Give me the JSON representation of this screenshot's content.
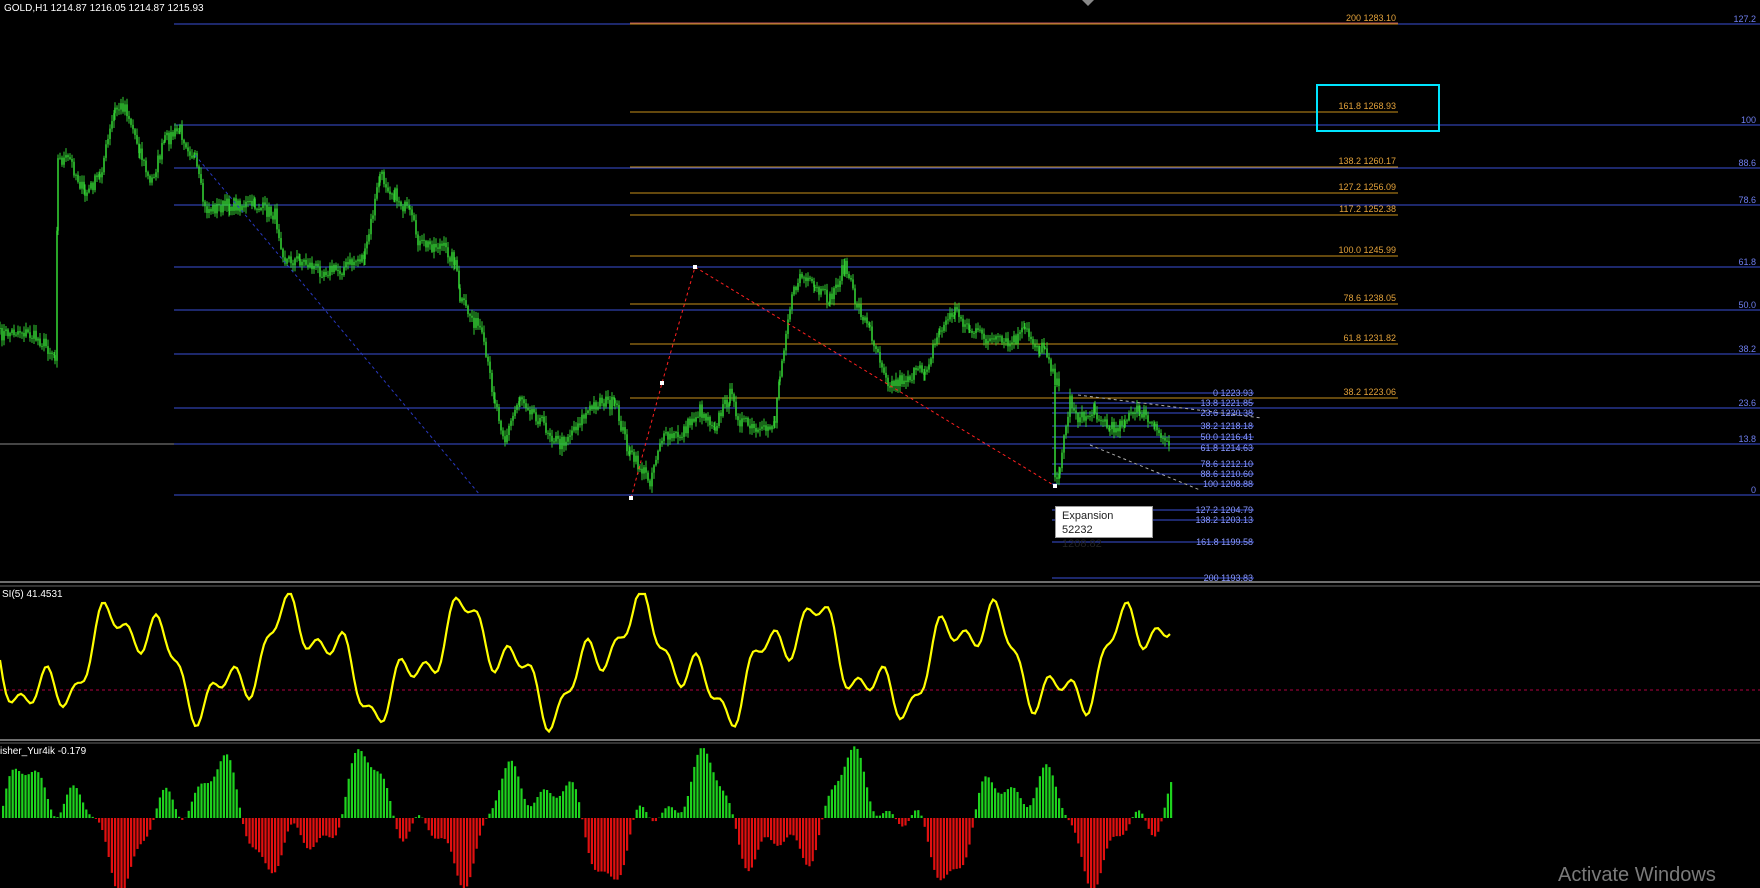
{
  "main": {
    "symbol_label": "GOLD,H1  1214.87 1216.05 1214.87 1215.93"
  },
  "indicator1": {
    "label": "SI(5) 41.4531"
  },
  "indicator2": {
    "label": "isher_Yur4ik -0.179"
  },
  "tooltip": {
    "line1": "Expansion 52232",
    "line2": "1208.82"
  },
  "watermark": "Activate Windows",
  "colors": {
    "price": "#32cd32",
    "fib_blue": "#3a4fd6",
    "fib_orange": "#c9901a",
    "si_line": "#ffff00",
    "hist_up": "#1ed31e",
    "hist_down": "#e01010",
    "zigzag": "#ff2020",
    "highlight": "#00e5ff"
  },
  "fib_retracement_labels": [
    "127.2",
    "100",
    "88.6",
    "78.6",
    "61.8",
    "50.0",
    "38.2",
    "23.6",
    "13.8",
    "0"
  ],
  "fib_expansion_labels": [
    "200 1283.10",
    "161.8 1268.93",
    "138.2 1260.17",
    "127.2 1256.09",
    "117.2 1252.38",
    "100.0   1245.99",
    "78.6 1238.05",
    "61.8 1231.82",
    "38.2 1223.06"
  ],
  "fib_small_labels": [
    "0 1223.93",
    "13.8 1221.85",
    "23.6 1220.38",
    "38.2 1218.18",
    "50.0 1216.41",
    "61.8 1214.63",
    "78.6 1212.10",
    "88.6 1210.60",
    "100 1208.88",
    "127.2 1204.79",
    "138.2 1203.13",
    "161.8 1199.58",
    "200 1193.83"
  ]
}
